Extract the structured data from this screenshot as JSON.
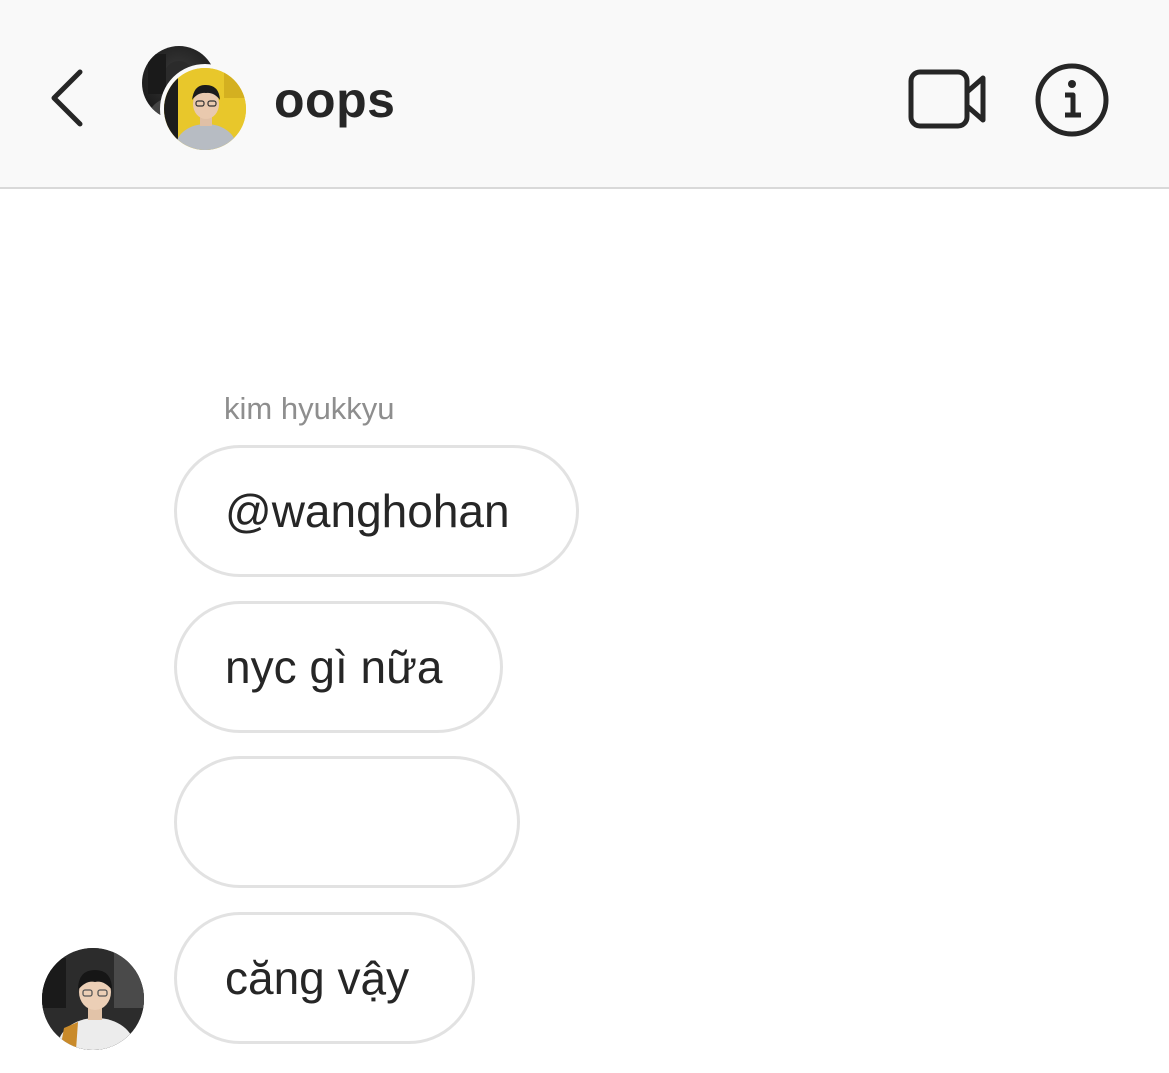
{
  "header": {
    "title": "oops",
    "back_icon": "chevron-left-icon",
    "video_icon": "video-camera-icon",
    "info_icon": "info-icon"
  },
  "conversation": {
    "sender_name": "kim hyukkyu",
    "messages": [
      {
        "text": "@wanghohan"
      },
      {
        "text": "nyc gì nữa"
      },
      {
        "text": ""
      },
      {
        "text": "căng vậy"
      }
    ]
  },
  "colors": {
    "header_bg": "#f9f9f9",
    "header_border": "#d9d9d9",
    "text_primary": "#262626",
    "text_secondary": "#8e8e8e",
    "bubble_border": "#e2e2e2"
  }
}
